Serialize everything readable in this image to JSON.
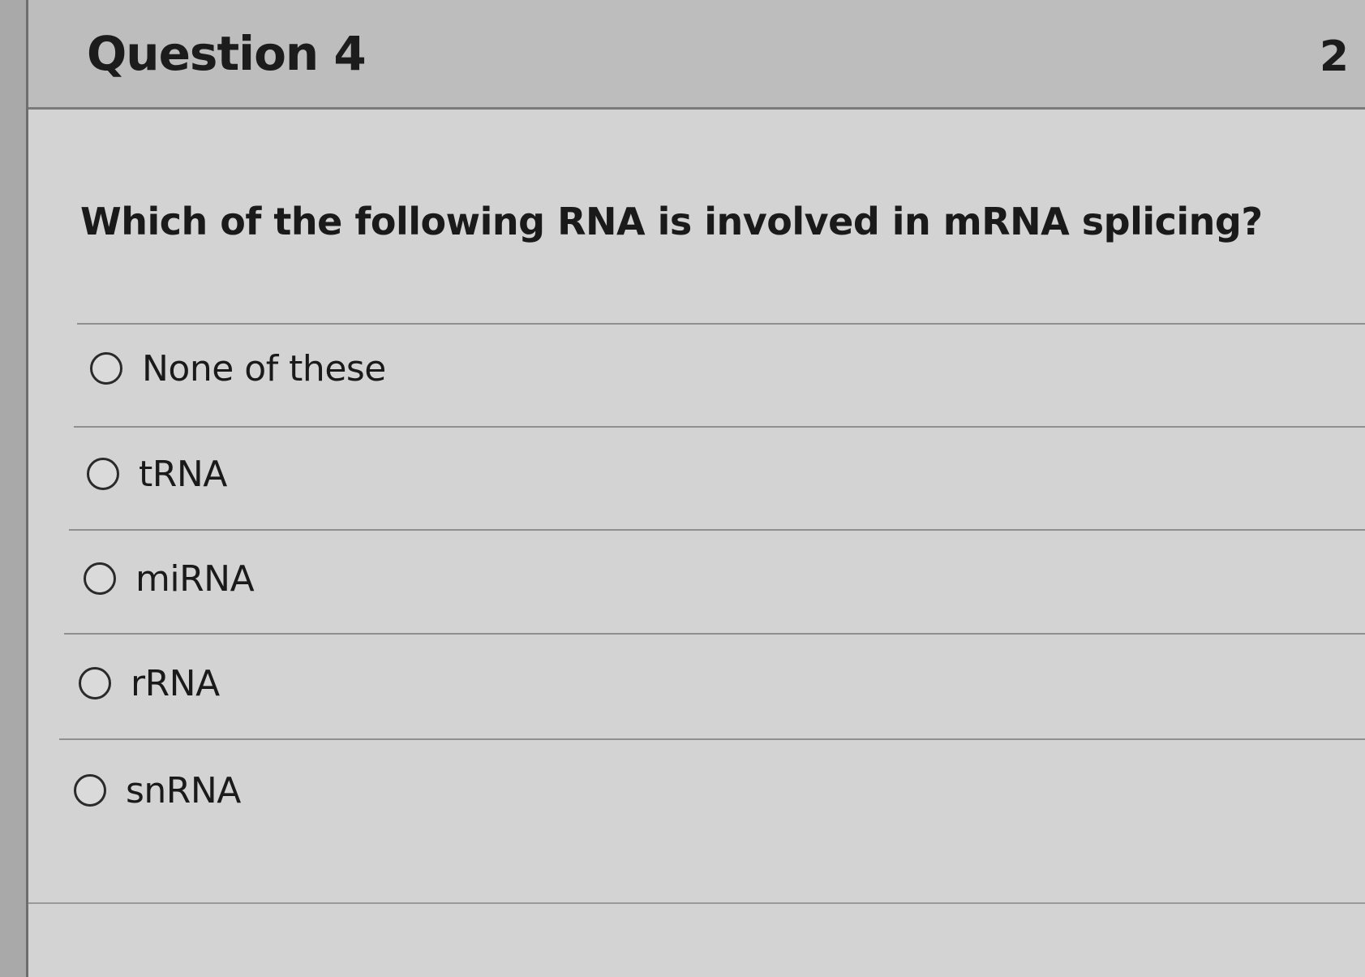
{
  "question": {
    "title": "Question 4",
    "points": "2",
    "prompt": "Which of the following RNA is involved in mRNA splicing?"
  },
  "answers": [
    {
      "label": "None of these",
      "selected": false
    },
    {
      "label": "tRNA",
      "selected": false
    },
    {
      "label": "miRNA",
      "selected": false
    },
    {
      "label": "rRNA",
      "selected": false
    },
    {
      "label": "snRNA",
      "selected": false
    }
  ]
}
